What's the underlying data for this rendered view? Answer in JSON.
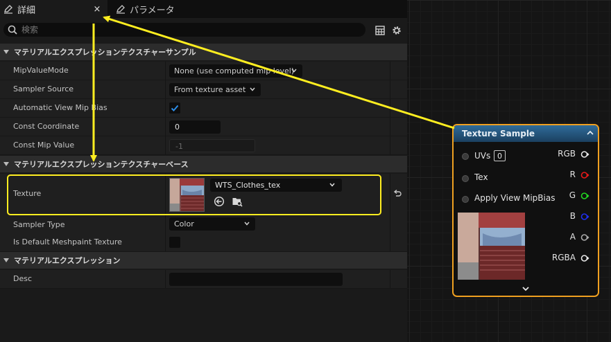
{
  "tabs": [
    {
      "label": "詳細",
      "active": true
    },
    {
      "label": "パラメータ",
      "active": false
    }
  ],
  "tab_close_glyph": "×",
  "search": {
    "placeholder": "検索",
    "icon": "search-icon"
  },
  "toolbar_icons": [
    "grid-view-icon",
    "gear-icon"
  ],
  "sections": [
    {
      "title": "マテリアルエクスプレッションテクスチャーサンプル"
    },
    {
      "title": "マテリアルエクスプレッションテクスチャーベース"
    },
    {
      "title": "マテリアルエクスプレッション"
    }
  ],
  "properties": {
    "mip_value_mode": {
      "label": "MipValueMode",
      "value": "None (use computed mip level)"
    },
    "sampler_source": {
      "label": "Sampler Source",
      "value": "From texture asset"
    },
    "automatic_view_mip_bias": {
      "label": "Automatic View Mip Bias",
      "checked": true
    },
    "const_coordinate": {
      "label": "Const Coordinate",
      "value": "0"
    },
    "const_mip_value": {
      "label": "Const Mip Value",
      "value": "-1"
    },
    "texture": {
      "label": "Texture",
      "value": "WTS_Clothes_tex"
    },
    "sampler_type": {
      "label": "Sampler Type",
      "value": "Color"
    },
    "is_default_meshpaint_texture": {
      "label": "Is Default Meshpaint Texture",
      "checked": false
    },
    "desc": {
      "label": "Desc",
      "value": ""
    }
  },
  "node": {
    "title": "Texture Sample",
    "inputs": [
      {
        "label": "UVs",
        "value": "0"
      },
      {
        "label": "Tex"
      },
      {
        "label": "Apply View MipBias"
      }
    ],
    "outputs": [
      {
        "label": "RGB",
        "color": "#e8e8e8"
      },
      {
        "label": "R",
        "color": "#e81919"
      },
      {
        "label": "G",
        "color": "#22d822"
      },
      {
        "label": "B",
        "color": "#1f2ff0"
      },
      {
        "label": "A",
        "color": "#a8a8a8"
      },
      {
        "label": "RGBA",
        "color": "#e8e8e8"
      }
    ]
  },
  "colors": {
    "highlight": "#ffee20",
    "node_border": "#f0a020",
    "accent_check": "#2d8fea"
  }
}
